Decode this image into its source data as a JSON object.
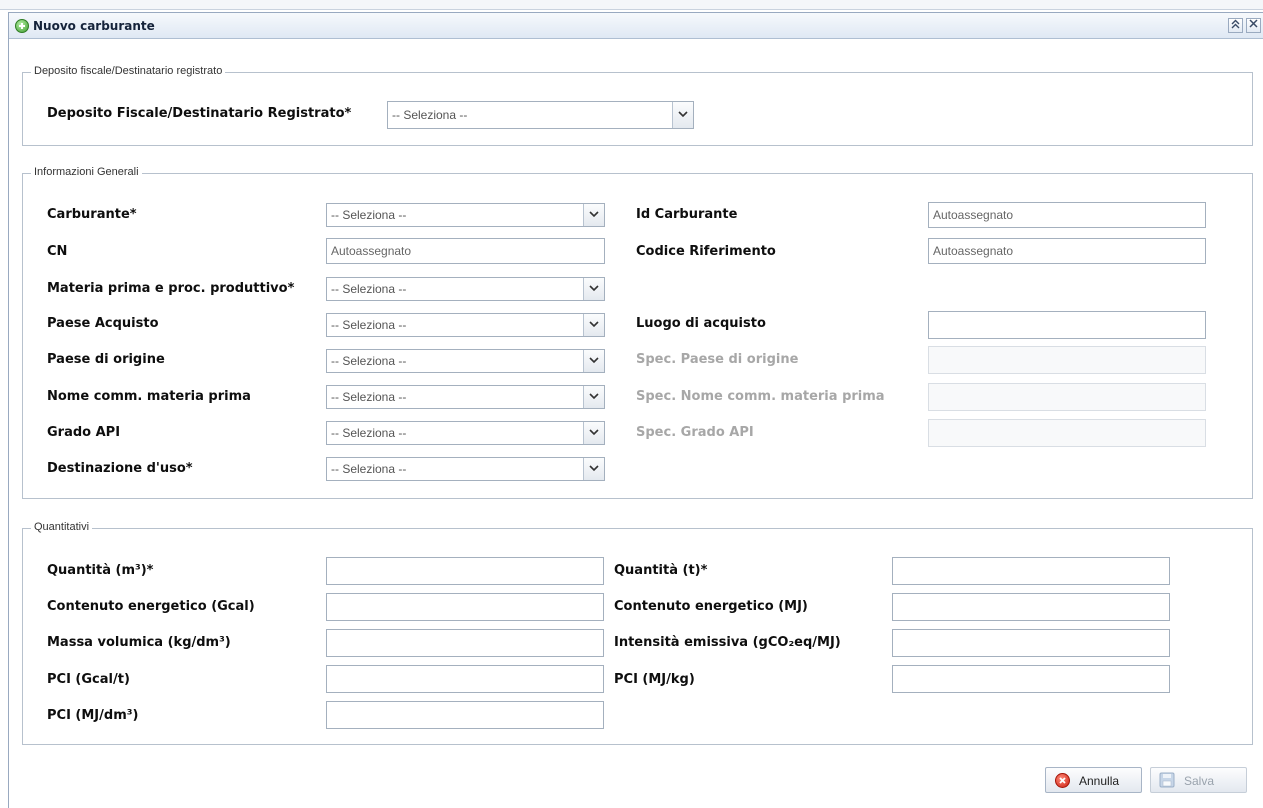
{
  "window": {
    "title": "Nuovo carburante",
    "collapse_icon": "double-chevron-up-icon",
    "close_icon": "close-icon"
  },
  "section_deposito": {
    "legend": "Deposito fiscale/Destinatario registrato",
    "label": "Deposito Fiscale/Destinatario Registrato*",
    "value": "-- Seleziona --"
  },
  "section_info": {
    "legend": "Informazioni Generali",
    "carburante_label": "Carburante*",
    "carburante_value": "-- Seleziona --",
    "cn_label": "CN",
    "cn_value": "Autoassegnato",
    "materia_label": "Materia prima e proc. produttivo*",
    "materia_value": "-- Seleziona --",
    "paese_acquisto_label": "Paese Acquisto",
    "paese_acquisto_value": "-- Seleziona --",
    "paese_origine_label": "Paese di origine",
    "paese_origine_value": "-- Seleziona --",
    "nome_comm_label": "Nome comm. materia prima",
    "nome_comm_value": "-- Seleziona --",
    "grado_api_label": "Grado API",
    "grado_api_value": "-- Seleziona --",
    "destinazione_label": "Destinazione d'uso*",
    "destinazione_value": "-- Seleziona --",
    "id_carburante_label": "Id Carburante",
    "id_carburante_value": "Autoassegnato",
    "codice_rif_label": "Codice Riferimento",
    "codice_rif_value": "Autoassegnato",
    "luogo_label": "Luogo di acquisto",
    "luogo_value": "",
    "spec_paese_label": "Spec. Paese di origine",
    "spec_nome_label": "Spec. Nome comm. materia prima",
    "spec_grado_label": "Spec. Grado API"
  },
  "section_quant": {
    "legend": "Quantitativi",
    "quantita_m3_label": "Quantità (m³)*",
    "contenuto_gcal_label": "Contenuto energetico (Gcal)",
    "massa_label": "Massa volumica (kg/dm³)",
    "pci_gcal_label": "PCI (Gcal/t)",
    "pci_mjdm3_label": "PCI (MJ/dm³)",
    "quantita_t_label": "Quantità (t)*",
    "contenuto_mj_label": "Contenuto energetico (MJ)",
    "intensita_label": "Intensità emissiva (gCO₂eq/MJ)",
    "pci_mjkg_label": "PCI (MJ/kg)"
  },
  "footer": {
    "annulla_label": "Annulla",
    "salva_label": "Salva"
  },
  "colors": {
    "window_border": "#99a9c0",
    "titlebar": "#dfe8f4",
    "disabled_text": "#a7a7a7"
  }
}
